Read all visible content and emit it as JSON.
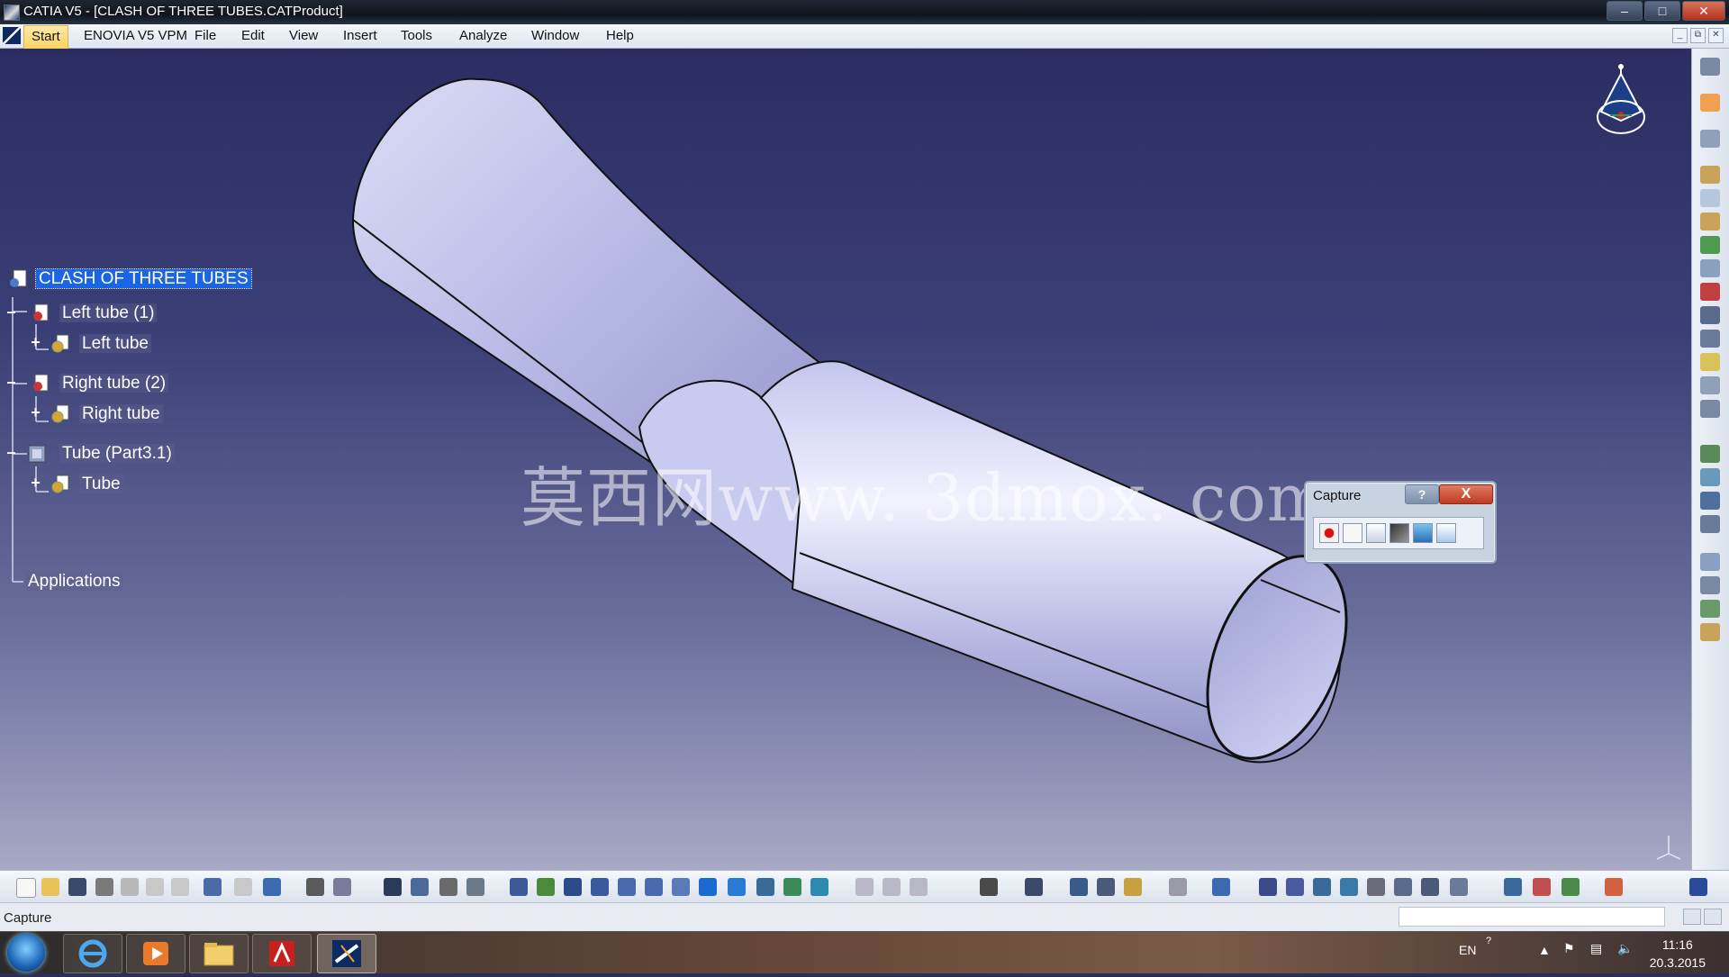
{
  "window": {
    "title": "CATIA V5 - [CLASH OF THREE TUBES.CATProduct]",
    "controls": {
      "minimize": "–",
      "maximize": "□",
      "close": "✕"
    }
  },
  "menu": {
    "items": [
      "Start",
      "ENOVIA V5 VPM",
      "File",
      "Edit",
      "View",
      "Insert",
      "Tools",
      "Analyze",
      "Window",
      "Help"
    ]
  },
  "tree": {
    "root": "CLASH OF THREE TUBES",
    "nodes": [
      "Left tube (1)",
      "Left tube",
      "Right tube (2)",
      "Right tube",
      "Tube (Part3.1)",
      "Tube",
      "Applications"
    ]
  },
  "watermark": "莫西网www. 3dmox. com",
  "capture_dialog": {
    "title": "Capture",
    "help": "?",
    "close": "X",
    "tools": [
      "record-icon",
      "select-icon",
      "options-icon",
      "capture-mode-icon",
      "album-icon",
      "graph-icon"
    ]
  },
  "status": {
    "text": "Capture"
  },
  "taskbar": {
    "apps": [
      "internet-explorer-icon",
      "media-player-icon",
      "file-explorer-icon",
      "acrobat-icon",
      "catia-icon"
    ],
    "language": "EN",
    "time": "11:16",
    "date": "20.3.2015"
  },
  "colors": {
    "tube_fill": "#b9bbe6",
    "tree_highlight": "#1a64e6",
    "viewport_top": "#2b2d62",
    "viewport_bottom": "#a7a9c6"
  }
}
